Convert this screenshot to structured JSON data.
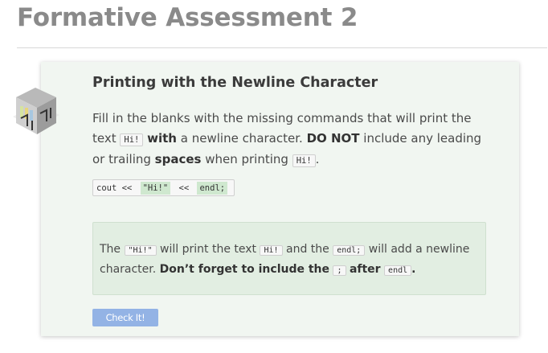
{
  "page": {
    "title": "Formative Assessment 2"
  },
  "card": {
    "title": "Printing with the Newline Character",
    "icon": "cube-icon",
    "prompt": {
      "p1": "Fill in the blanks with the missing commands that will print the text",
      "code_hi": "Hi!",
      "bold_with": "with",
      "p2": " a newline character. ",
      "bold_donot": "DO NOT",
      "p3": " include any leading or trailing ",
      "bold_spaces": "spaces",
      "p4": " when printing ",
      "p5": "."
    },
    "code": {
      "prefix": "cout << ",
      "blank1": "\"Hi!\"",
      "middle": " << ",
      "blank2": "endl;",
      "suffix": ""
    },
    "hint": {
      "t1": "The ",
      "code_quoted_hi": "\"Hi!\"",
      "t2": " will print the text ",
      "code_hi": "Hi!",
      "t3": " and the ",
      "code_endl_semicolon": "endl;",
      "t4": " will add a newline character. ",
      "bold_dont": "Don’t forget to include the",
      "code_semicolon": ";",
      "bold_after": "after",
      "code_endl": "endl",
      "bold_period": "."
    },
    "check_button_label": "Check It!",
    "colors": {
      "card_bg": "#f1f6f1",
      "blank_bg": "#cfe8cf",
      "hint_bg": "#e2eee2",
      "button_bg": "#93b3e5"
    }
  }
}
